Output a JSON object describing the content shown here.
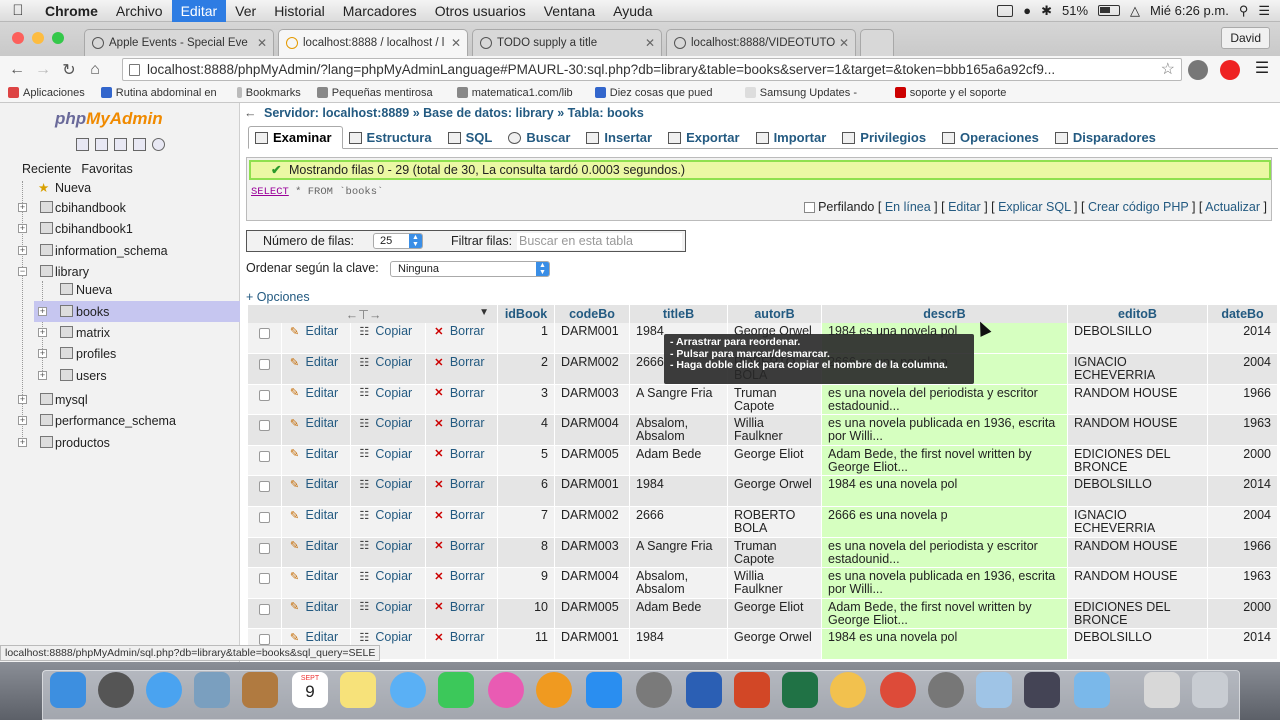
{
  "menubar": {
    "app": "Chrome",
    "items": [
      "Archivo",
      "Editar",
      "Ver",
      "Historial",
      "Marcadores",
      "Otros usuarios",
      "Ventana",
      "Ayuda"
    ],
    "active_item": "Editar",
    "battery": "51%",
    "clock": "Mié 6:26 p.m."
  },
  "tabs": [
    {
      "title": "Apple Events - Special Eve"
    },
    {
      "title": "localhost:8888 / localhost / l"
    },
    {
      "title": "TODO supply a title"
    },
    {
      "title": "localhost:8888/VIDEOTUTO"
    }
  ],
  "user_name": "David",
  "url": "localhost:8888/phpMyAdmin/?lang=phpMyAdminLanguage#PMAURL-30:sql.php?db=library&table=books&server=1&target=&token=bbb165a6a92cf9...",
  "bookmarks": [
    "Aplicaciones",
    "Rutina abdominal en",
    "Bookmarks",
    "Pequeñas mentirosa",
    "matematica1.com/lib",
    "Diez cosas que pued",
    "Samsung Updates -",
    "soporte y el soporte"
  ],
  "sidebar": {
    "logo_php": "php",
    "logo_my": "MyAdmin",
    "tab_recent": "Reciente",
    "tab_fav": "Favoritas",
    "tree": [
      "Nueva",
      "cbihandbook",
      "cbihandbook1",
      "information_schema",
      "library",
      "Nueva",
      "books",
      "matrix",
      "profiles",
      "users",
      "mysql",
      "performance_schema",
      "productos"
    ]
  },
  "breadcrumb": {
    "server": "Servidor: localhost:8889",
    "db": "Base de datos: library",
    "table": "Tabla: books",
    "sep": "»"
  },
  "main_tabs": [
    "Examinar",
    "Estructura",
    "SQL",
    "Buscar",
    "Insertar",
    "Exportar",
    "Importar",
    "Privilegios",
    "Operaciones",
    "Disparadores"
  ],
  "success_msg": "Mostrando filas 0 - 29 (total de 30, La consulta tardó 0.0003 segundos.)",
  "sql": {
    "kw1": "SELECT",
    "rest": " * FROM `books`"
  },
  "sql_links": {
    "profiling": "Perfilando",
    "links": [
      "En línea",
      "Editar",
      "Explicar SQL",
      "Crear código PHP",
      "Actualizar"
    ]
  },
  "nav": {
    "rows_label": "Número de filas:",
    "rows_value": "25",
    "filter_label": "Filtrar filas:",
    "filter_placeholder": "Buscar en esta tabla"
  },
  "sort": {
    "label": "Ordenar según la clave:",
    "value": "Ninguna"
  },
  "options_link": "+ Opciones",
  "table": {
    "columns": [
      "idBook",
      "codeBo",
      "titleB",
      "autorB",
      "descrB",
      "editoB",
      "dateBo"
    ],
    "actions": {
      "edit": "Editar",
      "copy": "Copiar",
      "delete": "Borrar"
    },
    "rows": [
      [
        "1",
        "DARM001",
        "1984",
        "George Orwel",
        "1984 es una novela pol",
        "DEBOLSILLO",
        "2014"
      ],
      [
        "2",
        "DARM002",
        "2666",
        "ROBERTO BOLA",
        "2666 es una novela p",
        "IGNACIO ECHEVERRIA",
        "2004"
      ],
      [
        "3",
        "DARM003",
        "A Sangre Fria",
        "Truman Capote",
        "es una novela del periodista y escritor estadounid...",
        "RANDOM HOUSE",
        "1966"
      ],
      [
        "4",
        "DARM004",
        "Absalom, Absalom",
        "Willia Faulkner",
        "es una novela publicada en 1936, escrita por Willi...",
        "RANDOM HOUSE",
        "1963"
      ],
      [
        "5",
        "DARM005",
        "Adam Bede",
        "George Eliot",
        "Adam Bede, the first novel written by George Eliot...",
        "EDICIONES DEL BRONCE",
        "2000"
      ],
      [
        "6",
        "DARM001",
        "1984",
        "George Orwel",
        "1984 es una novela pol",
        "DEBOLSILLO",
        "2014"
      ],
      [
        "7",
        "DARM002",
        "2666",
        "ROBERTO BOLA",
        "2666 es una novela p",
        "IGNACIO ECHEVERRIA",
        "2004"
      ],
      [
        "8",
        "DARM003",
        "A Sangre Fria",
        "Truman Capote",
        "es una novela del periodista y escritor estadounid...",
        "RANDOM HOUSE",
        "1966"
      ],
      [
        "9",
        "DARM004",
        "Absalom, Absalom",
        "Willia Faulkner",
        "es una novela publicada en 1936, escrita por Willi...",
        "RANDOM HOUSE",
        "1963"
      ],
      [
        "10",
        "DARM005",
        "Adam Bede",
        "George Eliot",
        "Adam Bede, the first novel written by George Eliot...",
        "EDICIONES DEL BRONCE",
        "2000"
      ],
      [
        "11",
        "DARM001",
        "1984",
        "George Orwel",
        "1984 es una novela pol",
        "DEBOLSILLO",
        "2014"
      ]
    ]
  },
  "tooltip": [
    "- Arrastrar para reordenar.",
    "- Pulsar para marcar/desmarcar.",
    "- Haga doble click para copiar el nombre de la columna."
  ],
  "status_url": "localhost:8888/phpMyAdmin/sql.php?db=library&table=books&sql_query=SELE",
  "dock_calendar": {
    "month": "SEPT",
    "day": "9"
  }
}
